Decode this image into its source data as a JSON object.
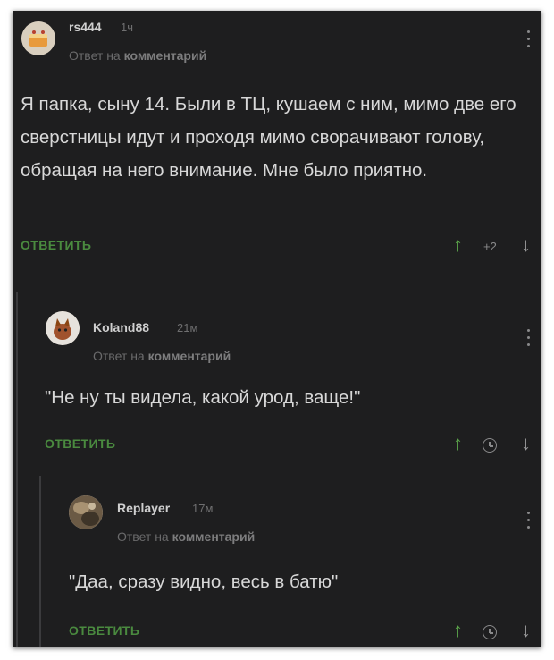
{
  "comments": [
    {
      "username": "rs444",
      "time": "1ч",
      "reply_prefix": "Ответ на",
      "reply_target": "комментарий",
      "text": "Я папка,  сыну 14. Были в ТЦ,  кушаем с ним, мимо две его сверстницы идут и проходя мимо сворачивают голову,  обращая на него внимание.  Мне было приятно.",
      "reply_label": "ОТВЕТИТЬ",
      "rating": "+2",
      "avatar_icon": "cake-avatar"
    },
    {
      "username": "Koland88",
      "time": "21м",
      "reply_prefix": "Ответ на",
      "reply_target": "комментарий",
      "text": "\"Не ну ты видела, какой урод, ваще!\"",
      "reply_label": "ОТВЕТИТЬ",
      "avatar_icon": "cat-avatar"
    },
    {
      "username": "Replayer",
      "time": "17м",
      "reply_prefix": "Ответ на",
      "reply_target": "комментарий",
      "text": "\"Даа, сразу видно, весь в батю\"",
      "reply_label": "ОТВЕТИТЬ",
      "avatar_icon": "photo-avatar"
    }
  ],
  "icons": {
    "up": "↑",
    "down": "↓"
  },
  "colors": {
    "background": "#1e1e1f",
    "accent_green": "#4a8a3f",
    "text": "#d8d8d8"
  }
}
